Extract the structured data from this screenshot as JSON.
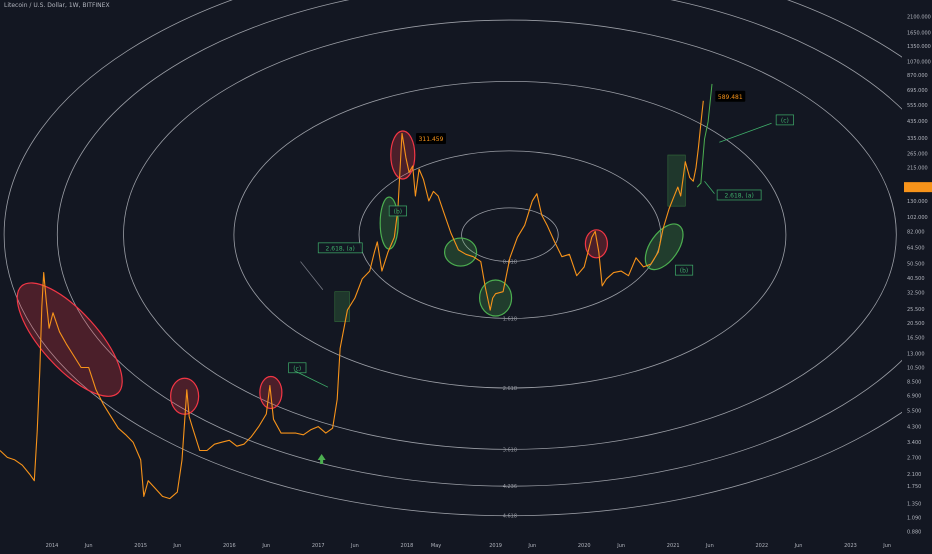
{
  "header": {
    "title": "Litecoin / U.S. Dollar, 1W, BITFINEX"
  },
  "colors": {
    "background": "#131722",
    "price_line": "#f7931a",
    "circle": "#c9ccd3",
    "red_highlight": "#f23645",
    "green_highlight": "#4caf50",
    "label_green": "#3fae6a",
    "price_tag": "#000000",
    "current_price_tag": "#f7931a"
  },
  "chart_data": {
    "type": "line",
    "title": "Litecoin / U.S. Dollar, 1W, BITFINEX",
    "y_scale": "log",
    "ylim": [
      0.8,
      2700
    ],
    "xlim": [
      "2013-06-01",
      "2023-08-01"
    ],
    "x_tick_labels": [
      {
        "label": "Jun",
        "date": "2013-06-01"
      },
      {
        "label": "2014",
        "date": "2014-01-01"
      },
      {
        "label": "Jun",
        "date": "2014-06-01"
      },
      {
        "label": "2015",
        "date": "2015-01-01"
      },
      {
        "label": "Jun",
        "date": "2015-06-01"
      },
      {
        "label": "2016",
        "date": "2016-01-01"
      },
      {
        "label": "Jun",
        "date": "2016-06-01"
      },
      {
        "label": "2017",
        "date": "2017-01-01"
      },
      {
        "label": "Jun",
        "date": "2017-06-01"
      },
      {
        "label": "2018",
        "date": "2018-01-01"
      },
      {
        "label": "May",
        "date": "2018-05-01"
      },
      {
        "label": "2019",
        "date": "2019-01-01"
      },
      {
        "label": "Jun",
        "date": "2019-06-01"
      },
      {
        "label": "2020",
        "date": "2020-01-01"
      },
      {
        "label": "Jun",
        "date": "2020-06-01"
      },
      {
        "label": "2021",
        "date": "2021-01-01"
      },
      {
        "label": "Jun",
        "date": "2021-06-01"
      },
      {
        "label": "2022",
        "date": "2022-01-01"
      },
      {
        "label": "Jun",
        "date": "2022-06-01"
      },
      {
        "label": "2023",
        "date": "2023-01-01"
      },
      {
        "label": "Jun",
        "date": "2023-06-01"
      }
    ],
    "y_tick_labels": [
      {
        "label": "2700.000",
        "value": 2700
      },
      {
        "label": "2100.000",
        "value": 2100
      },
      {
        "label": "1650.000",
        "value": 1650
      },
      {
        "label": "1350.000",
        "value": 1350
      },
      {
        "label": "1070.000",
        "value": 1070
      },
      {
        "label": "870.000",
        "value": 870
      },
      {
        "label": "695.000",
        "value": 695
      },
      {
        "label": "555.000",
        "value": 555
      },
      {
        "label": "435.000",
        "value": 435
      },
      {
        "label": "335.000",
        "value": 335
      },
      {
        "label": "265.000",
        "value": 265
      },
      {
        "label": "215.000",
        "value": 215
      },
      {
        "label": "130.000",
        "value": 130
      },
      {
        "label": "102.000",
        "value": 102
      },
      {
        "label": "82.000",
        "value": 82
      },
      {
        "label": "64.500",
        "value": 64.5
      },
      {
        "label": "50.500",
        "value": 50.5
      },
      {
        "label": "40.500",
        "value": 40.5
      },
      {
        "label": "32.500",
        "value": 32.5
      },
      {
        "label": "25.500",
        "value": 25.5
      },
      {
        "label": "20.500",
        "value": 20.5
      },
      {
        "label": "16.500",
        "value": 16.5
      },
      {
        "label": "13.000",
        "value": 13.0
      },
      {
        "label": "10.500",
        "value": 10.5
      },
      {
        "label": "8.500",
        "value": 8.5
      },
      {
        "label": "6.900",
        "value": 6.9
      },
      {
        "label": "5.500",
        "value": 5.5
      },
      {
        "label": "4.300",
        "value": 4.3
      },
      {
        "label": "3.400",
        "value": 3.4
      },
      {
        "label": "2.700",
        "value": 2.7
      },
      {
        "label": "2.100",
        "value": 2.1
      },
      {
        "label": "1.750",
        "value": 1.75
      },
      {
        "label": "1.350",
        "value": 1.35
      },
      {
        "label": "1.090",
        "value": 1.09
      },
      {
        "label": "0.880",
        "value": 0.88
      }
    ],
    "current_price": {
      "label": "",
      "value": 160
    },
    "series": [
      {
        "values": [
          [
            "2013-06-01",
            3.0
          ],
          [
            "2013-07-01",
            2.7
          ],
          [
            "2013-08-01",
            2.6
          ],
          [
            "2013-09-01",
            2.4
          ],
          [
            "2013-10-01",
            2.1
          ],
          [
            "2013-10-20",
            1.9
          ],
          [
            "2013-11-01",
            4.0
          ],
          [
            "2013-11-12",
            10.0
          ],
          [
            "2013-11-20",
            26.0
          ],
          [
            "2013-11-28",
            44.0
          ],
          [
            "2013-12-08",
            29.0
          ],
          [
            "2013-12-20",
            19.0
          ],
          [
            "2014-01-05",
            24.0
          ],
          [
            "2014-02-01",
            18.0
          ],
          [
            "2014-03-01",
            15.0
          ],
          [
            "2014-04-01",
            12.5
          ],
          [
            "2014-05-01",
            10.5
          ],
          [
            "2014-06-01",
            10.5
          ],
          [
            "2014-07-01",
            7.5
          ],
          [
            "2014-08-01",
            6.0
          ],
          [
            "2014-09-01",
            5.0
          ],
          [
            "2014-10-01",
            4.2
          ],
          [
            "2014-11-01",
            3.8
          ],
          [
            "2014-12-01",
            3.4
          ],
          [
            "2015-01-01",
            2.6
          ],
          [
            "2015-01-14",
            1.5
          ],
          [
            "2015-02-01",
            1.9
          ],
          [
            "2015-03-01",
            1.7
          ],
          [
            "2015-04-01",
            1.5
          ],
          [
            "2015-05-01",
            1.45
          ],
          [
            "2015-06-01",
            1.6
          ],
          [
            "2015-06-20",
            2.6
          ],
          [
            "2015-07-10",
            7.5
          ],
          [
            "2015-07-20",
            5.0
          ],
          [
            "2015-08-01",
            4.3
          ],
          [
            "2015-09-01",
            3.0
          ],
          [
            "2015-10-01",
            3.0
          ],
          [
            "2015-11-01",
            3.3
          ],
          [
            "2015-12-01",
            3.4
          ],
          [
            "2016-01-01",
            3.5
          ],
          [
            "2016-02-01",
            3.2
          ],
          [
            "2016-03-01",
            3.3
          ],
          [
            "2016-04-01",
            3.7
          ],
          [
            "2016-05-01",
            4.3
          ],
          [
            "2016-06-01",
            5.2
          ],
          [
            "2016-06-16",
            8.0
          ],
          [
            "2016-07-01",
            4.8
          ],
          [
            "2016-08-01",
            3.9
          ],
          [
            "2016-09-01",
            3.9
          ],
          [
            "2016-10-01",
            3.9
          ],
          [
            "2016-11-01",
            3.8
          ],
          [
            "2016-12-01",
            4.1
          ],
          [
            "2017-01-01",
            4.3
          ],
          [
            "2017-02-01",
            3.9
          ],
          [
            "2017-03-01",
            4.2
          ],
          [
            "2017-03-20",
            6.5
          ],
          [
            "2017-04-01",
            14.0
          ],
          [
            "2017-05-01",
            25.0
          ],
          [
            "2017-06-01",
            30.0
          ],
          [
            "2017-07-01",
            40.0
          ],
          [
            "2017-08-01",
            45.0
          ],
          [
            "2017-08-20",
            60.0
          ],
          [
            "2017-09-01",
            70.0
          ],
          [
            "2017-09-20",
            45.0
          ],
          [
            "2017-10-15",
            60.0
          ],
          [
            "2017-11-10",
            75.0
          ],
          [
            "2017-11-25",
            115.0
          ],
          [
            "2017-12-12",
            360.0
          ],
          [
            "2017-12-20",
            300.0
          ],
          [
            "2017-12-28",
            250.0
          ],
          [
            "2018-01-10",
            200.0
          ],
          [
            "2018-01-25",
            220.0
          ],
          [
            "2018-02-05",
            140.0
          ],
          [
            "2018-02-20",
            210.0
          ],
          [
            "2018-03-10",
            180.0
          ],
          [
            "2018-04-01",
            130.0
          ],
          [
            "2018-04-20",
            150.0
          ],
          [
            "2018-05-10",
            140.0
          ],
          [
            "2018-06-01",
            110.0
          ],
          [
            "2018-07-01",
            80.0
          ],
          [
            "2018-08-01",
            62.0
          ],
          [
            "2018-09-01",
            58.0
          ],
          [
            "2018-10-01",
            56.0
          ],
          [
            "2018-11-01",
            52.0
          ],
          [
            "2018-11-20",
            35.0
          ],
          [
            "2018-12-10",
            25.0
          ],
          [
            "2018-12-20",
            30.0
          ],
          [
            "2019-01-01",
            32.0
          ],
          [
            "2019-02-01",
            33.0
          ],
          [
            "2019-03-01",
            55.0
          ],
          [
            "2019-04-01",
            75.0
          ],
          [
            "2019-05-01",
            90.0
          ],
          [
            "2019-06-01",
            130.0
          ],
          [
            "2019-06-20",
            145.0
          ],
          [
            "2019-07-10",
            105.0
          ],
          [
            "2019-08-01",
            90.0
          ],
          [
            "2019-09-01",
            70.0
          ],
          [
            "2019-10-01",
            56.0
          ],
          [
            "2019-11-01",
            58.0
          ],
          [
            "2019-12-01",
            42.0
          ],
          [
            "2020-01-01",
            48.0
          ],
          [
            "2020-02-01",
            75.0
          ],
          [
            "2020-02-15",
            82.0
          ],
          [
            "2020-03-01",
            60.0
          ],
          [
            "2020-03-15",
            36.0
          ],
          [
            "2020-04-01",
            40.0
          ],
          [
            "2020-05-01",
            44.0
          ],
          [
            "2020-06-01",
            45.0
          ],
          [
            "2020-07-01",
            42.0
          ],
          [
            "2020-08-01",
            55.0
          ],
          [
            "2020-09-01",
            48.0
          ],
          [
            "2020-10-01",
            50.0
          ],
          [
            "2020-11-01",
            60.0
          ],
          [
            "2020-11-20",
            85.0
          ],
          [
            "2020-12-15",
            115.0
          ],
          [
            "2021-01-01",
            135.0
          ],
          [
            "2021-01-20",
            160.0
          ],
          [
            "2021-02-01",
            140.0
          ],
          [
            "2021-02-20",
            235.0
          ],
          [
            "2021-03-10",
            185.0
          ],
          [
            "2021-03-25",
            175.0
          ],
          [
            "2021-04-05",
            215.0
          ],
          [
            "2021-04-15",
            290.0
          ],
          [
            "2021-04-25",
            420.0
          ],
          [
            "2021-05-05",
            589.48
          ]
        ]
      }
    ],
    "circles": {
      "center": {
        "date": "2019-03-01",
        "value": 78
      },
      "labels": [
        {
          "label": "0.618",
          "value": 52
        },
        {
          "label": "1.618",
          "value": 22
        },
        {
          "label": "2.618",
          "value": 7.7
        },
        {
          "label": "3.618",
          "value": 3.05
        },
        {
          "label": "4.236",
          "value": 1.75
        },
        {
          "label": "4.618",
          "value": 1.12
        }
      ]
    },
    "annotations": {
      "price_tags": [
        {
          "text": "311.459",
          "date": "2017-12-20",
          "value": 311.459
        },
        {
          "text": "589.481",
          "date": "2021-05-05",
          "value": 589.481
        }
      ],
      "wave_labels": [
        {
          "text": "(b)",
          "date": "2017-10-20",
          "value": 110
        },
        {
          "text": "2.618, (a)",
          "date": "2017-01-01",
          "value": 63
        },
        {
          "text": "(c)",
          "date": "2016-09-01",
          "value": 10.3
        },
        {
          "text": "(b)",
          "date": "2021-01-10",
          "value": 45
        },
        {
          "text": "2.618, (a)",
          "date": "2021-07-01",
          "value": 140
        },
        {
          "text": "(c)",
          "date": "2022-03-01",
          "value": 435
        }
      ]
    }
  }
}
